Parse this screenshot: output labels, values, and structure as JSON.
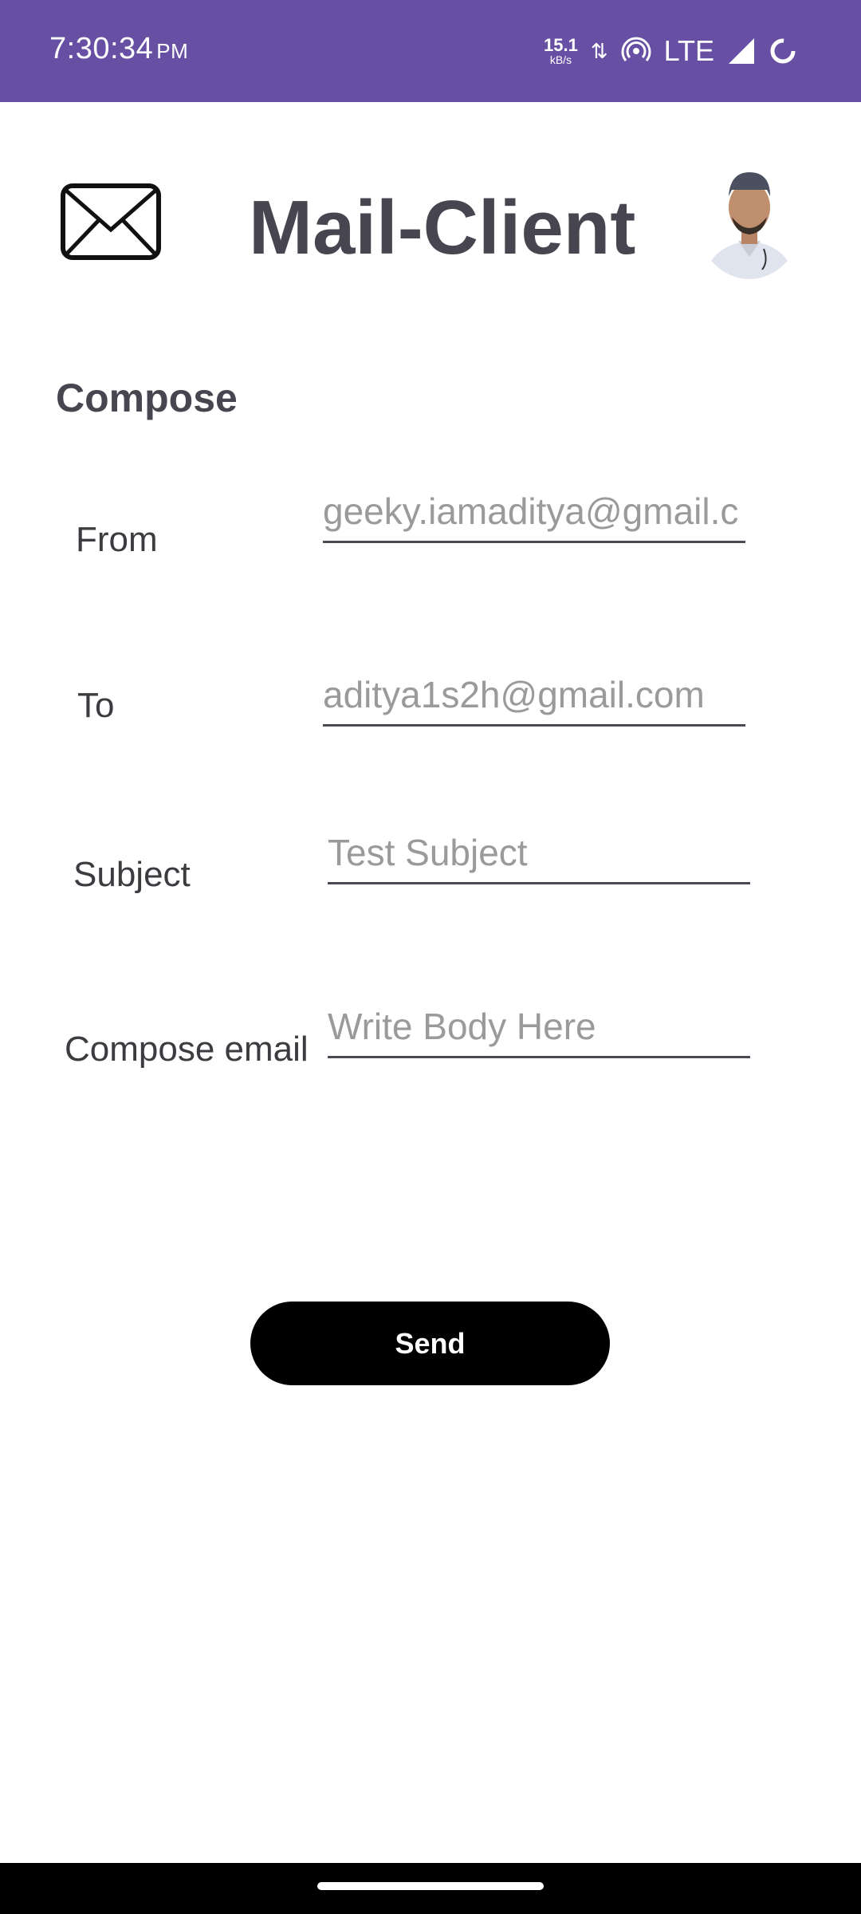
{
  "status_bar": {
    "time": "7:30:34",
    "ampm": "PM",
    "net_speed": "15.1",
    "net_unit": "kB/s",
    "network": "LTE",
    "background_color": "#6750a4",
    "icons": [
      "data-arrows-icon",
      "hotspot-icon",
      "signal-icon",
      "loading-circle-icon"
    ]
  },
  "header": {
    "title": "Mail-Client",
    "logo_icon": "envelope-icon",
    "avatar_icon": "profile-avatar"
  },
  "compose": {
    "section_title": "Compose",
    "fields": [
      {
        "label": "From",
        "placeholder": "geeky.iamaditya@gmail.c"
      },
      {
        "label": "To",
        "placeholder": "aditya1s2h@gmail.com"
      },
      {
        "label": "Subject",
        "placeholder": "Test Subject"
      },
      {
        "label": "Compose email",
        "placeholder": "Write Body Here"
      }
    ],
    "send_label": "Send"
  }
}
